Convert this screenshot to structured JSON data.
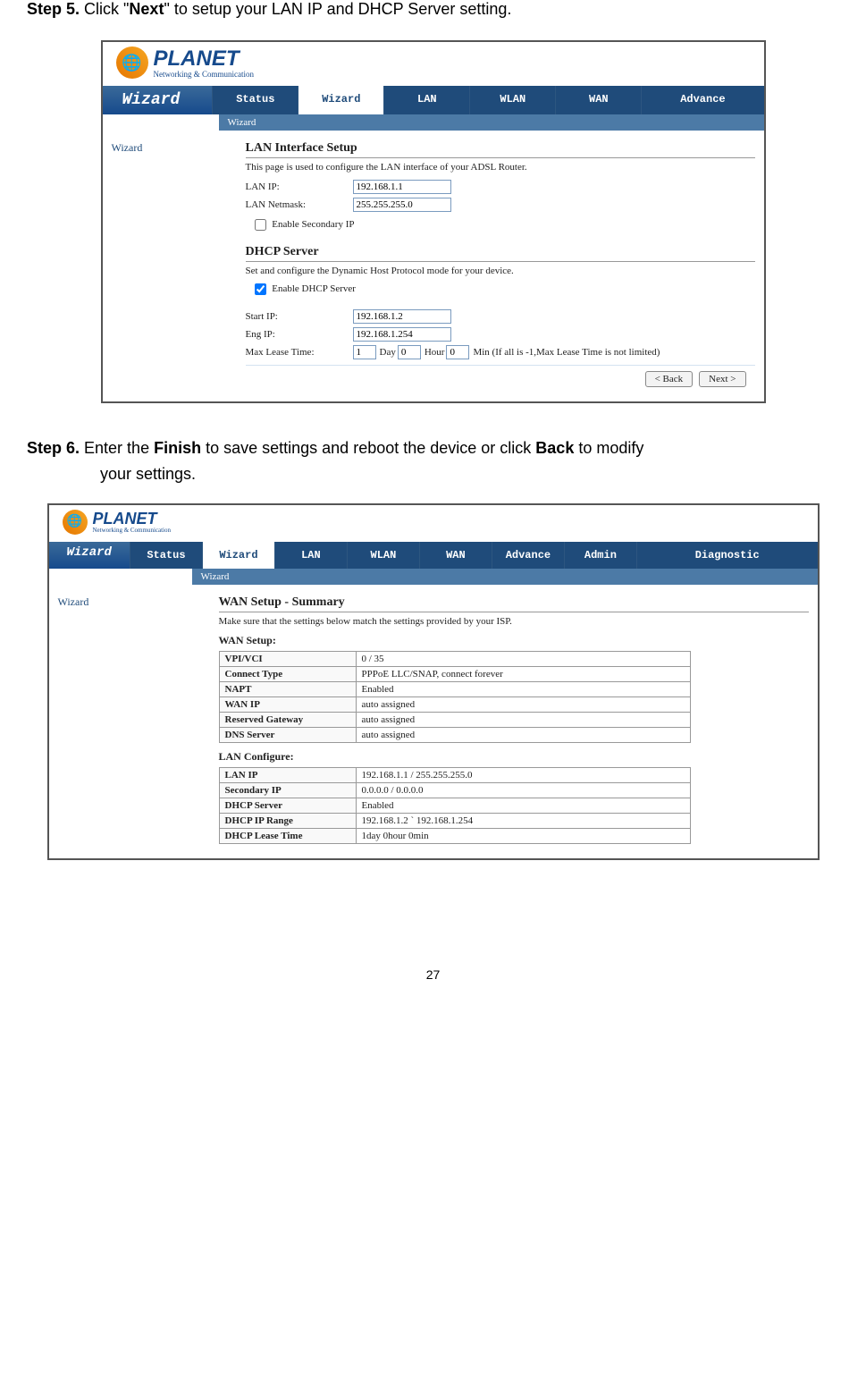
{
  "doc": {
    "step5_prefix": "Step 5.",
    "step5_text_a": "  Click \"",
    "step5_bold": "Next",
    "step5_text_b": "\" to setup your LAN IP and DHCP Server setting.",
    "step6_prefix": "Step 6.",
    "step6_text_a": "  Enter the ",
    "step6_bold1": "Finish",
    "step6_text_b": " to save settings and reboot the device or click ",
    "step6_bold2": "Back",
    "step6_text_c": " to modify",
    "step6_line2": "your settings.",
    "page_number": "27"
  },
  "logo": {
    "brand": "PLANET",
    "tagline": "Networking & Communication"
  },
  "shot1": {
    "nav_title": "Wizard",
    "nav_items": [
      "Status",
      "Wizard",
      "LAN",
      "WLAN",
      "WAN",
      "Advance"
    ],
    "breadcrumb": "Wizard",
    "sidebar": "Wizard",
    "h_lan": "LAN Interface Setup",
    "lan_desc": "This page is used to configure the LAN interface of your ADSL Router.",
    "lan_ip_lbl": "LAN IP:",
    "lan_ip_val": "192.168.1.1",
    "lan_mask_lbl": "LAN Netmask:",
    "lan_mask_val": "255.255.255.0",
    "enable_sec_ip": "Enable Secondary IP",
    "h_dhcp": "DHCP Server",
    "dhcp_desc": "Set and configure the Dynamic Host Protocol mode for your device.",
    "enable_dhcp": "Enable DHCP Server",
    "start_ip_lbl": "Start IP:",
    "start_ip_val": "192.168.1.2",
    "end_ip_lbl": "Eng IP:",
    "end_ip_val": "192.168.1.254",
    "lease_lbl": "Max Lease Time:",
    "lease_day_val": "1",
    "lease_hour_val": "0",
    "lease_min_val": "0",
    "lease_day_txt": "Day",
    "lease_hour_txt": "Hour",
    "lease_min_txt": "Min (If all is -1,Max Lease Time is not limited)",
    "btn_back": "< Back",
    "btn_next": "Next >"
  },
  "shot2": {
    "nav_title": "Wizard",
    "nav_items": [
      "Status",
      "Wizard",
      "LAN",
      "WLAN",
      "WAN",
      "Advance",
      "Admin",
      "Diagnostic"
    ],
    "breadcrumb": "Wizard",
    "sidebar": "Wizard",
    "h_summary": "WAN Setup - Summary",
    "summary_desc": "Make sure that the settings below match the settings provided by your ISP.",
    "h_wan": "WAN Setup:",
    "wan_rows": [
      [
        "VPI/VCI",
        "0 / 35"
      ],
      [
        "Connect Type",
        "PPPoE LLC/SNAP, connect forever"
      ],
      [
        "NAPT",
        "Enabled"
      ],
      [
        "WAN IP",
        "auto assigned"
      ],
      [
        "Reserved Gateway",
        "auto assigned"
      ],
      [
        "DNS Server",
        "auto assigned"
      ]
    ],
    "h_lanconf": "LAN Configure:",
    "lan_rows": [
      [
        "LAN IP",
        "192.168.1.1 / 255.255.255.0"
      ],
      [
        "Secondary IP",
        "0.0.0.0 / 0.0.0.0"
      ],
      [
        "DHCP Server",
        "Enabled"
      ],
      [
        "DHCP IP Range",
        "192.168.1.2   ` 192.168.1.254"
      ],
      [
        "DHCP Lease Time",
        "1day 0hour 0min"
      ]
    ]
  }
}
